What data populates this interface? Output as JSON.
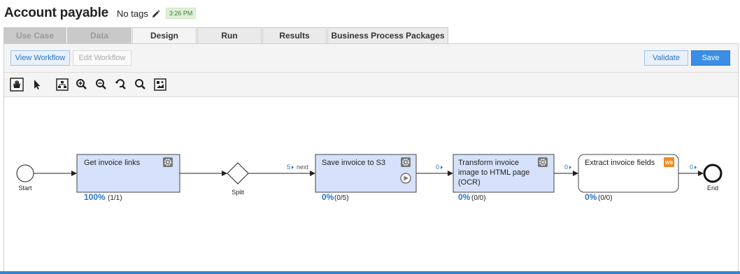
{
  "header": {
    "title": "Account payable",
    "tags": "No tags",
    "time": "3:26 PM"
  },
  "tabs": [
    {
      "label": "Use Case",
      "state": "disabled"
    },
    {
      "label": "Data",
      "state": "disabled"
    },
    {
      "label": "Design",
      "state": "active"
    },
    {
      "label": "Run",
      "state": "normal"
    },
    {
      "label": "Results",
      "state": "normal"
    },
    {
      "label": "Business Process Packages",
      "state": "normal"
    }
  ],
  "toolbar": {
    "view_workflow": "View Workflow",
    "edit_workflow": "Edit Workflow",
    "validate": "Validate",
    "save": "Save"
  },
  "tools": [
    "hand-icon",
    "pointer-icon",
    "layout-icon",
    "zoom-in-icon",
    "zoom-out-icon",
    "zoom-reset-icon",
    "zoom-icon",
    "fit-icon"
  ],
  "workflow": {
    "start_label": "Start",
    "end_label": "End",
    "split_label": "Split",
    "nodes": [
      {
        "title_lines": [
          "Get invoice links"
        ],
        "percent": "100%",
        "count": "(1/1)"
      },
      {
        "title_lines": [
          "Save invoice to S3"
        ],
        "percent": "0%",
        "count": "(0/5)"
      },
      {
        "title_lines": [
          "Transform invoice",
          "image to HTML page",
          "(OCR)"
        ],
        "percent": "0%",
        "count": "(0/0)"
      },
      {
        "title_lines": [
          "Extract invoice fields"
        ],
        "percent": "0%",
        "count": "(0/0)",
        "badge": "WS"
      }
    ],
    "connectors": [
      {
        "count": "5",
        "label": "next"
      },
      {
        "count": "0"
      },
      {
        "count": "0"
      },
      {
        "count": "0"
      }
    ],
    "colors": {
      "node_fill": "#d6e2fb",
      "node_stroke": "#444444",
      "accent": "#2a73c2",
      "ws_badge": "#f08a24"
    }
  }
}
